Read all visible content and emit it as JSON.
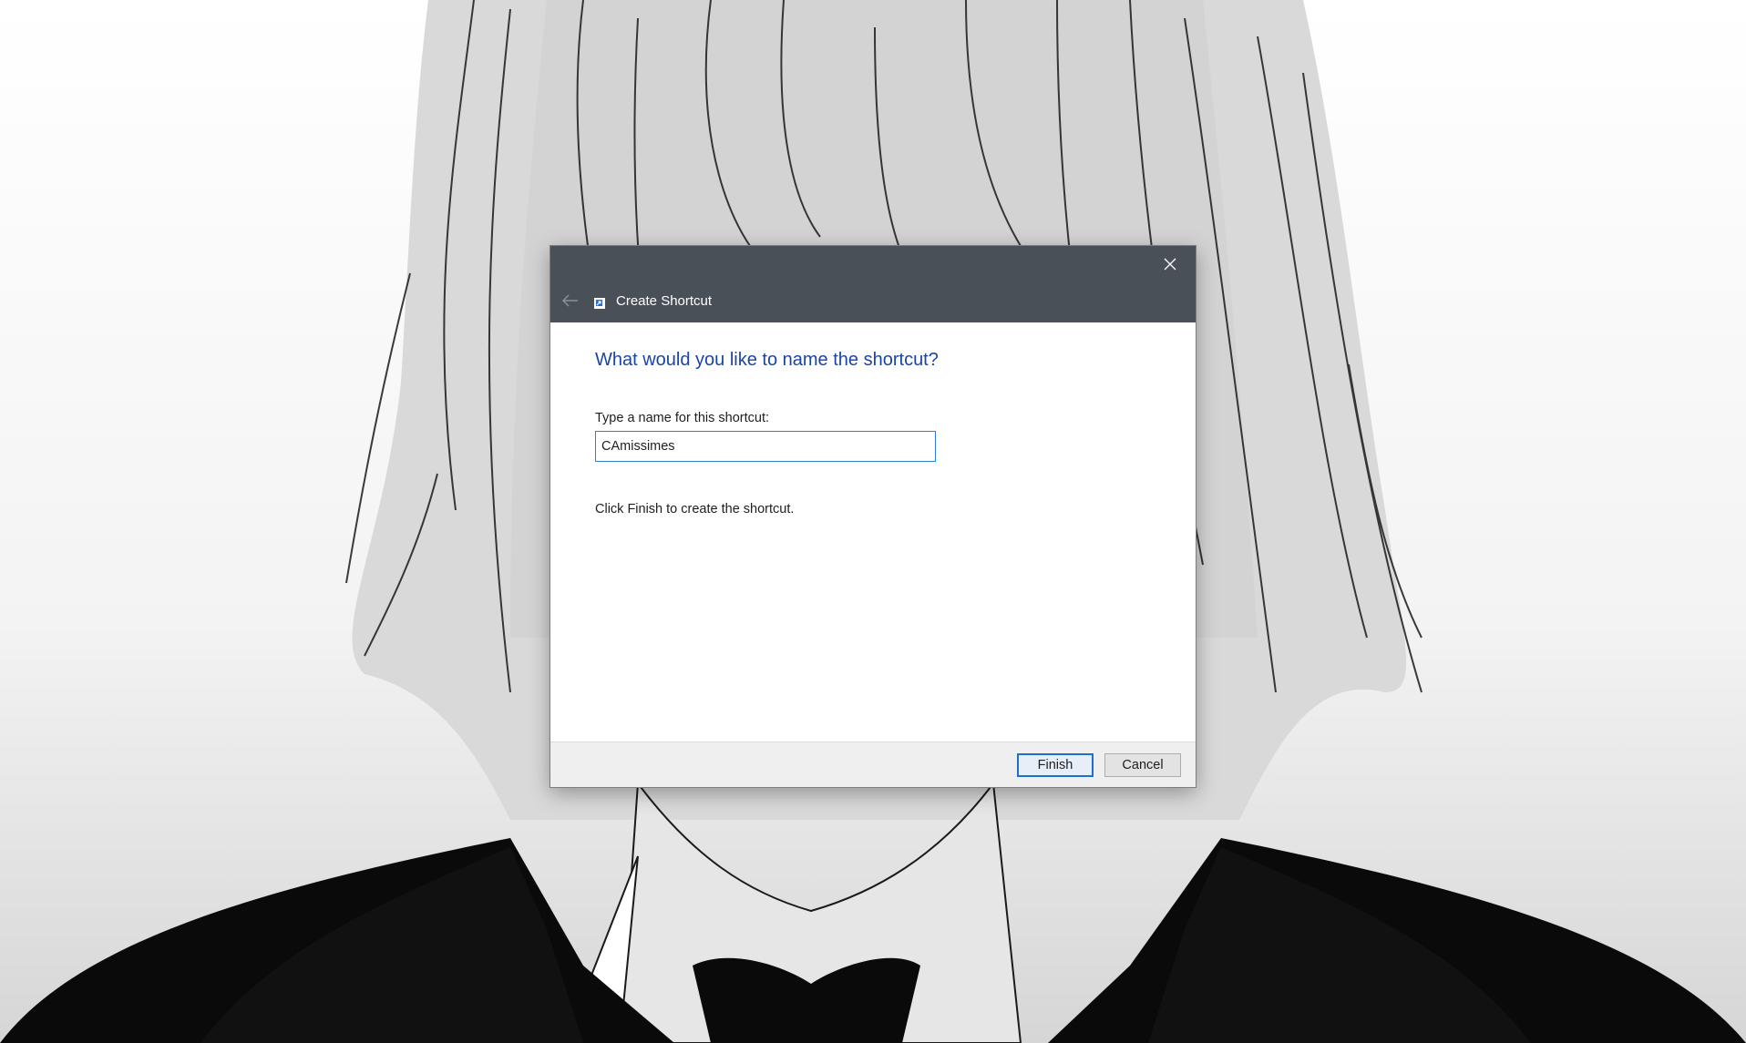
{
  "dialog": {
    "title": "Create Shortcut",
    "heading": "What would you like to name the shortcut?",
    "name_label": "Type a name for this shortcut:",
    "name_value": "CAmissimes",
    "hint": "Click Finish to create the shortcut.",
    "finish_label": "Finish",
    "cancel_label": "Cancel",
    "icons": {
      "back": "back-arrow-icon",
      "close": "close-icon",
      "app": "shortcut-icon"
    }
  },
  "colors": {
    "titlebar": "#4a5057",
    "heading": "#1a44a6",
    "focus_border": "#2f7fd4",
    "footer": "#efefef"
  },
  "wallpaper": {
    "description_icon": "anime-character-wallpaper"
  }
}
